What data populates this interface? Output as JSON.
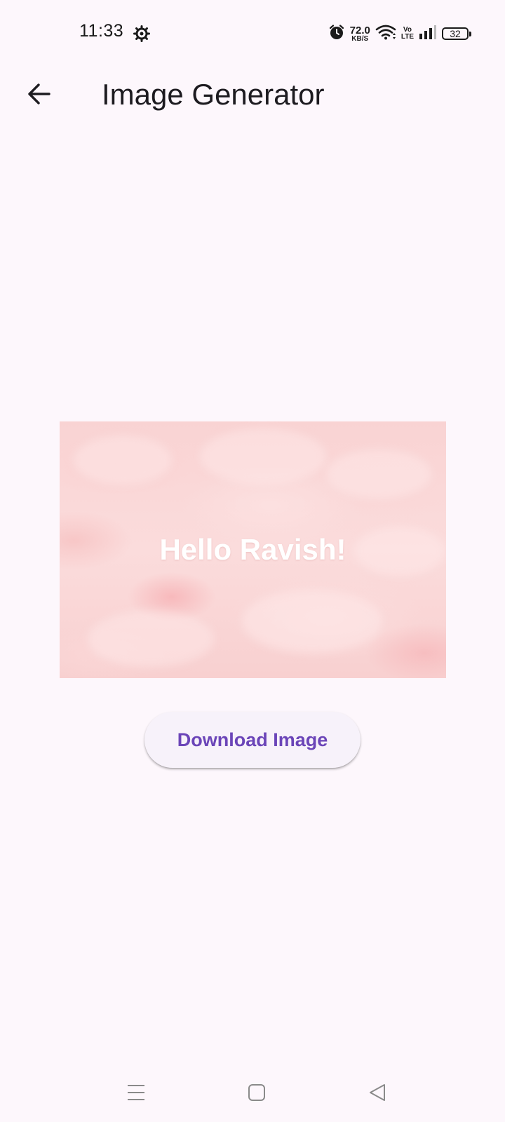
{
  "status_bar": {
    "time": "11:33",
    "net_speed_value": "72.0",
    "net_speed_unit": "KB/S",
    "volte_top": "Vo",
    "volte_bottom": "LTE",
    "battery": "32",
    "icons": [
      "settings-gear-icon",
      "alarm-icon",
      "wifi-icon",
      "volte-icon",
      "signal-icon",
      "battery-icon"
    ]
  },
  "app_bar": {
    "title": "Image Generator",
    "back_icon": "arrow-back-icon"
  },
  "generated_image": {
    "text": "Hello Ravish!"
  },
  "actions": {
    "download_label": "Download Image"
  },
  "nav_bar": {
    "icons": [
      "menu-icon",
      "home-icon",
      "back-icon"
    ]
  },
  "colors": {
    "background": "#fdf7fc",
    "accent": "#6b45b8",
    "button_bg": "#f7f2fa",
    "image_tint": "#f9d3d3"
  }
}
